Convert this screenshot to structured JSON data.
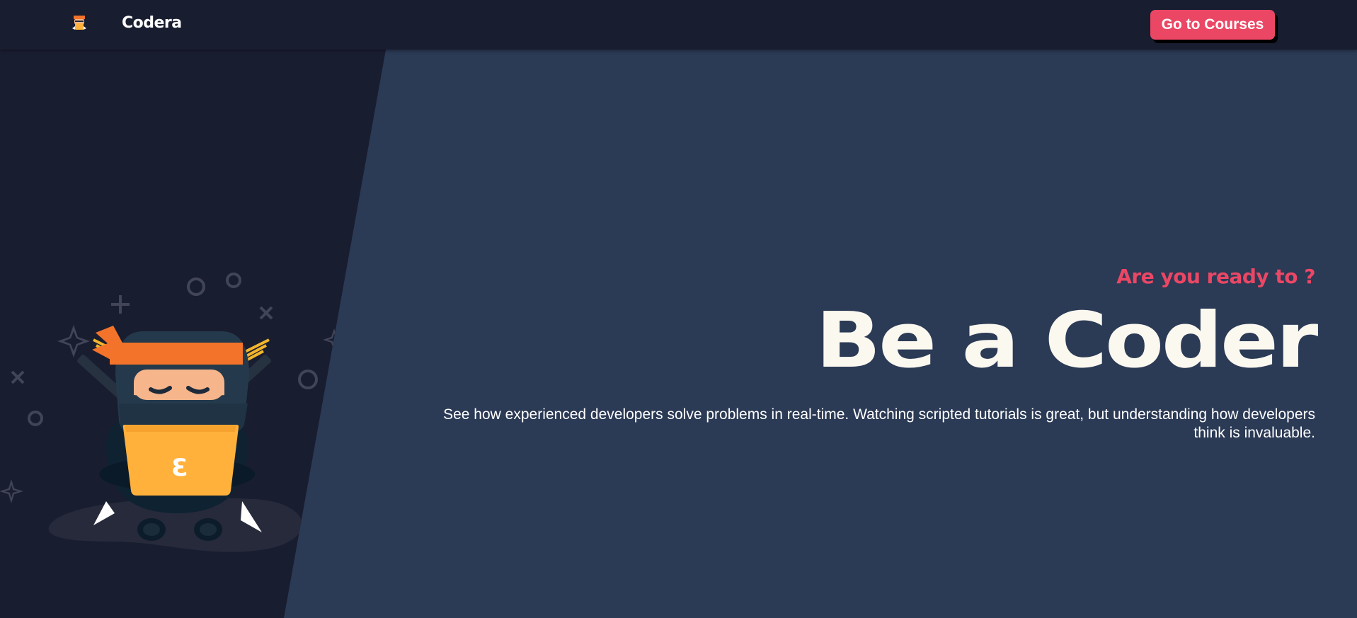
{
  "header": {
    "brand_name": "Codera",
    "logo_icon": "ninja-logo-icon",
    "cta_label": "Go to Courses"
  },
  "hero": {
    "subheading": "Are you ready to ?",
    "headline": "Be a Coder",
    "description": "See how experienced developers solve problems in real-time. Watching scripted tutorials is great, but understanding how developers think is invaluable.",
    "illustration": "ninja-coder-illustration",
    "laptop_logo_glyph": "Ɛ"
  },
  "colors": {
    "header_bg": "#191d30",
    "page_bg": "#2b3a55",
    "accent": "#eb4765",
    "headline": "#fbf8ef",
    "headband": "#f27329",
    "laptop": "#ffb13c"
  }
}
